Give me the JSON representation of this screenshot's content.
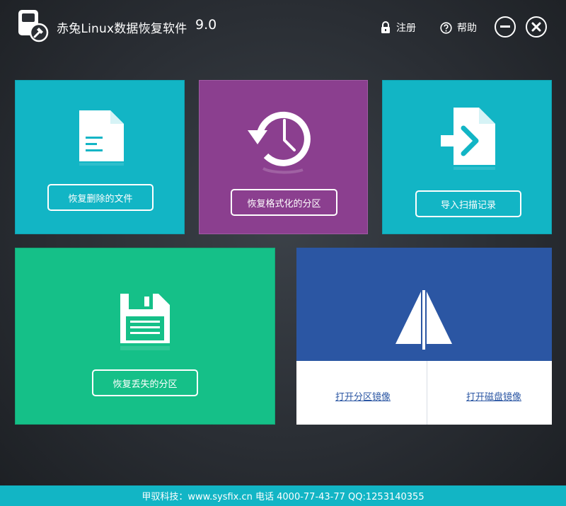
{
  "header": {
    "title": "赤兔Linux数据恢复软件",
    "version": "9.0",
    "register_label": "注册",
    "help_label": "帮助"
  },
  "tiles": {
    "recover_deleted": {
      "label": "恢复删除的文件",
      "icon": "document-icon",
      "color": "#12b5c5"
    },
    "recover_formatted": {
      "label": "恢复格式化的分区",
      "icon": "history-clock-icon",
      "color": "#8b3f8f"
    },
    "import_scan": {
      "label": "导入扫描记录",
      "icon": "file-import-icon",
      "color": "#12b5c5"
    },
    "recover_lost": {
      "label": "恢复丢失的分区",
      "icon": "floppy-disk-icon",
      "color": "#15c088"
    },
    "image": {
      "icon": "sail-mirror-icon",
      "color": "#2b56a3",
      "open_partition_image": "打开分区镜像",
      "open_disk_image": "打开磁盘镜像"
    }
  },
  "footer": {
    "text": "甲驭科技：www.sysfix.cn 电话 4000-77-43-77 QQ:1253140355"
  }
}
